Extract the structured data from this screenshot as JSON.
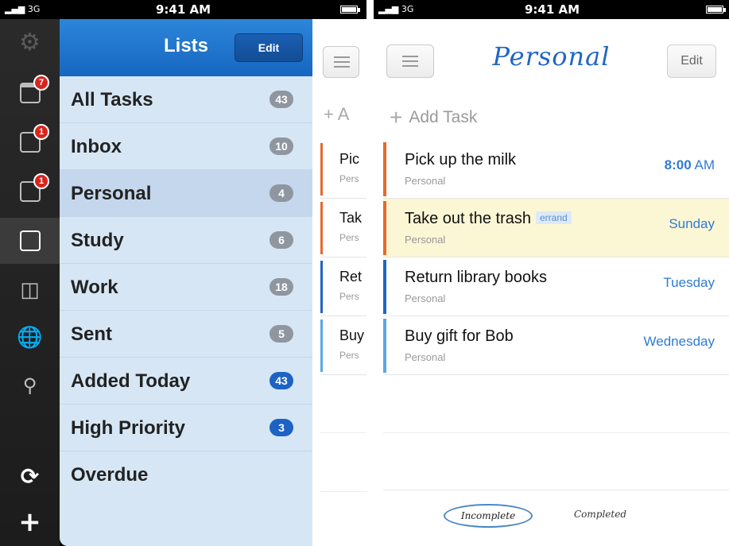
{
  "status_bar": {
    "signal": "▂▄▆ 3G",
    "time": "9:41 AM"
  },
  "rail": {
    "badges": [
      "7",
      "1",
      "1"
    ],
    "icons": [
      "gear-icon",
      "calendar-icon",
      "doc-4-icon",
      "doc-5-icon",
      "lists-icon",
      "tag-icon",
      "globe-icon",
      "search-icon",
      "sync-icon",
      "plus-icon"
    ]
  },
  "lists": {
    "title": "Lists",
    "edit_label": "Edit",
    "items": [
      {
        "label": "All Tasks",
        "count": "43"
      },
      {
        "label": "Inbox",
        "count": "10"
      },
      {
        "label": "Personal",
        "count": "4"
      },
      {
        "label": "Study",
        "count": "6"
      },
      {
        "label": "Work",
        "count": "18"
      },
      {
        "label": "Sent",
        "count": "5"
      },
      {
        "label": "Added Today",
        "count": "43"
      },
      {
        "label": "High Priority",
        "count": "3"
      },
      {
        "label": "Overdue",
        "count": ""
      }
    ]
  },
  "peek": {
    "add_label": "+ A",
    "rows": [
      {
        "title": "Pic",
        "sub": "Pers"
      },
      {
        "title": "Tak",
        "sub": "Pers"
      },
      {
        "title": "Ret",
        "sub": "Pers"
      },
      {
        "title": "Buy",
        "sub": "Pers"
      }
    ]
  },
  "personal": {
    "title": "Personal",
    "edit_label": "Edit",
    "add_task": "Add Task",
    "add_plus": "+",
    "tasks": [
      {
        "title": "Pick up the milk",
        "list": "Personal",
        "due_num": "8:00",
        "due_suffix": " AM",
        "tag": ""
      },
      {
        "title": "Take out the trash",
        "list": "Personal",
        "due": "Sunday",
        "tag": "errand"
      },
      {
        "title": "Return library books",
        "list": "Personal",
        "due": "Tuesday",
        "tag": ""
      },
      {
        "title": "Buy gift for Bob",
        "list": "Personal",
        "due": "Wednesday",
        "tag": ""
      }
    ],
    "filters": {
      "incomplete": "Incomplete",
      "completed": "Completed"
    }
  },
  "colors": {
    "priority_high": "#e8692a",
    "priority_medium": "#1f66c2",
    "priority_low": "#5aa6e6",
    "header_blue": "#1c6fca",
    "highlight": "#fbf6d4"
  }
}
